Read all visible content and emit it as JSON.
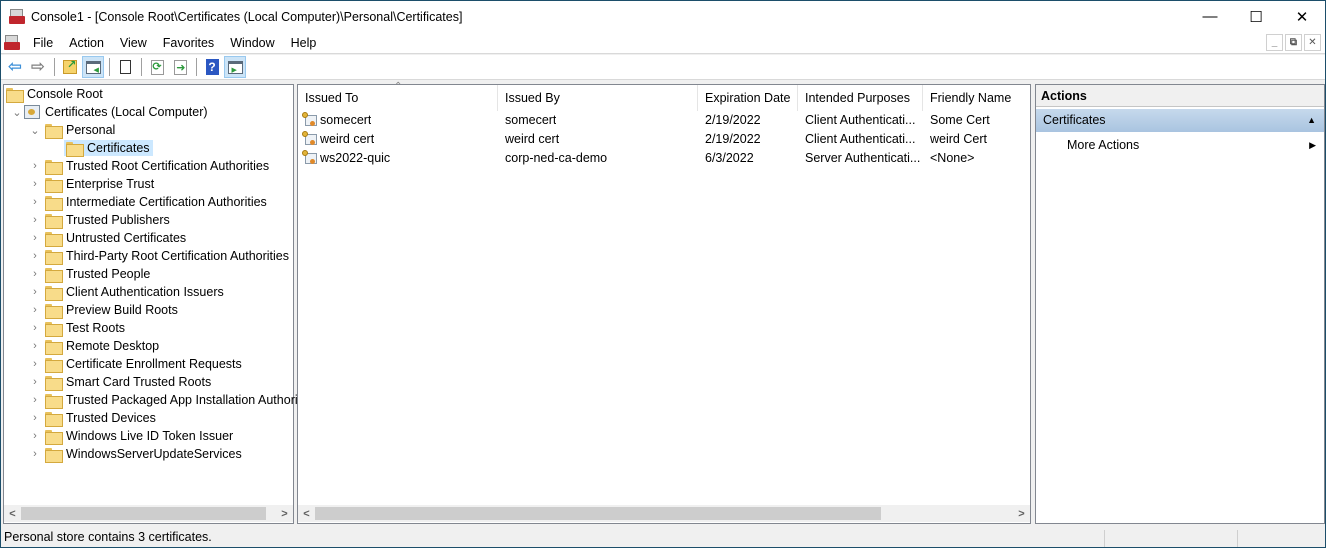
{
  "window": {
    "title": "Console1 - [Console Root\\Certificates (Local Computer)\\Personal\\Certificates]",
    "controls": {
      "minimize": "—",
      "maximize": "☐",
      "close": "✕"
    }
  },
  "menubar": {
    "items": [
      "File",
      "Action",
      "View",
      "Favorites",
      "Window",
      "Help"
    ],
    "mdi_controls": {
      "minimize": "_",
      "restore": "⧉",
      "close": "✕"
    }
  },
  "toolbar": {
    "buttons": [
      {
        "icon": "back-arrow-icon",
        "glyph": "⇦",
        "color": "#3c8fd8"
      },
      {
        "icon": "forward-arrow-icon",
        "glyph": "⇨",
        "color": "#808080"
      },
      {
        "icon": "up-one-level-icon",
        "glyph": "↰",
        "color": "#e0a620"
      },
      {
        "icon": "show-hide-console-tree-icon",
        "glyph": "◧",
        "color": "#4a7fb0",
        "active": true
      },
      {
        "icon": "properties-icon",
        "glyph": "▤",
        "color": "#333333"
      },
      {
        "icon": "refresh-icon",
        "glyph": "⟳",
        "color": "#2c9a3c"
      },
      {
        "icon": "export-list-icon",
        "glyph": "⇥",
        "color": "#2c9a3c"
      },
      {
        "icon": "help-icon",
        "glyph": "?",
        "color": "#ffffff",
        "bg": "#2b57c2"
      },
      {
        "icon": "show-hide-action-pane-icon",
        "glyph": "◨",
        "color": "#2c9a3c",
        "active": true
      }
    ]
  },
  "tree": {
    "root": "Console Root",
    "snapin": "Certificates (Local Computer)",
    "personal": "Personal",
    "selected": "Certificates",
    "stores": [
      "Trusted Root Certification Authorities",
      "Enterprise Trust",
      "Intermediate Certification Authorities",
      "Trusted Publishers",
      "Untrusted Certificates",
      "Third-Party Root Certification Authorities",
      "Trusted People",
      "Client Authentication Issuers",
      "Preview Build Roots",
      "Test Roots",
      "Remote Desktop",
      "Certificate Enrollment Requests",
      "Smart Card Trusted Roots",
      "Trusted Packaged App Installation Authorit",
      "Trusted Devices",
      "Windows Live ID Token Issuer",
      "WindowsServerUpdateServices"
    ]
  },
  "list": {
    "columns": [
      "Issued To",
      "Issued By",
      "Expiration Date",
      "Intended Purposes",
      "Friendly Name"
    ],
    "sort_column": "Issued To",
    "rows": [
      {
        "issued_to": "somecert",
        "issued_by": "somecert",
        "expiration": "2/19/2022",
        "purposes": "Client Authenticati...",
        "friendly": "Some Cert"
      },
      {
        "issued_to": "weird cert",
        "issued_by": "weird cert",
        "expiration": "2/19/2022",
        "purposes": "Client Authenticati...",
        "friendly": "weird Cert"
      },
      {
        "issued_to": "ws2022-quic",
        "issued_by": "corp-ned-ca-demo",
        "expiration": "6/3/2022",
        "purposes": "Server Authenticati...",
        "friendly": "<None>"
      }
    ]
  },
  "actions": {
    "header": "Actions",
    "section": "Certificates",
    "items": [
      "More Actions"
    ]
  },
  "status": {
    "text": "Personal store contains 3 certificates."
  },
  "scroll": {
    "left_arrow": "<",
    "right_arrow": ">"
  },
  "colors": {
    "selection": "#cce8ff",
    "toolbar_active": "#cce4f7",
    "actions_section": "#b7cfe7"
  }
}
